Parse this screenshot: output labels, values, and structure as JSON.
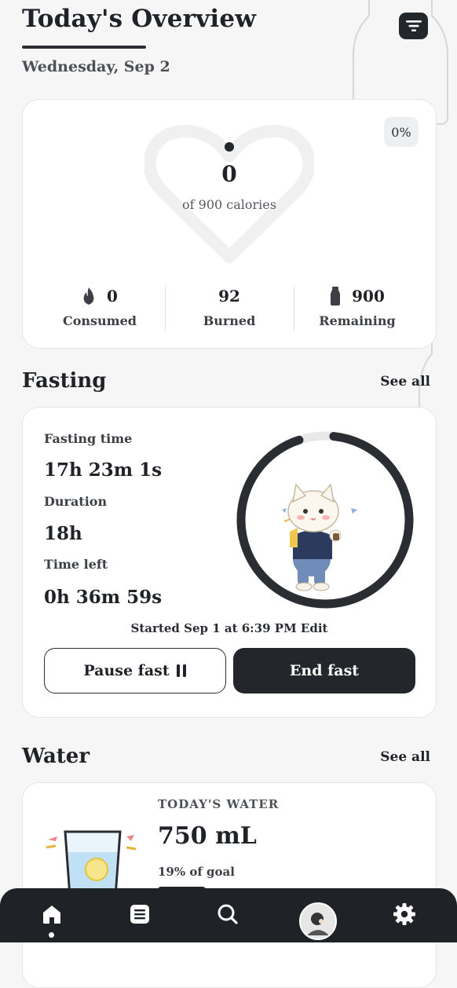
{
  "header": {
    "title": "Today's Overview",
    "date": "Wednesday, Sep 2"
  },
  "calories": {
    "percent_badge": "0%",
    "value": "0",
    "subtitle": "of 900 calories",
    "stats": [
      {
        "icon": "flame-icon",
        "value": "0",
        "label": "Consumed"
      },
      {
        "icon": "",
        "value": "92",
        "label": "Burned"
      },
      {
        "icon": "milk-bottle-icon",
        "value": "900",
        "label": "Remaining"
      }
    ]
  },
  "fasting": {
    "section_title": "Fasting",
    "see_all": "See all",
    "fasting_time_label": "Fasting time",
    "fasting_time_value": "17h 23m 1s",
    "duration_label": "Duration",
    "duration_value": "18h",
    "time_left_label": "Time left",
    "time_left_value": "0h 36m 59s",
    "progress_fraction": 0.966,
    "started_text": "Started Sep 1 at 6:39 PM Edit",
    "pause_button": "Pause fast",
    "end_button": "End fast"
  },
  "water": {
    "section_title": "Water",
    "see_all": "See all",
    "label": "TODAY'S WATER",
    "value": "750 mL",
    "goal_text": "19% of goal",
    "goal_fraction": 0.19
  },
  "nav": {
    "items": [
      "home-icon",
      "list-icon",
      "search-icon",
      "avatar",
      "gear-icon"
    ],
    "active": "home-icon"
  },
  "colors": {
    "dark": "#23262a",
    "card": "#ffffff",
    "background": "#f6f6f7"
  }
}
